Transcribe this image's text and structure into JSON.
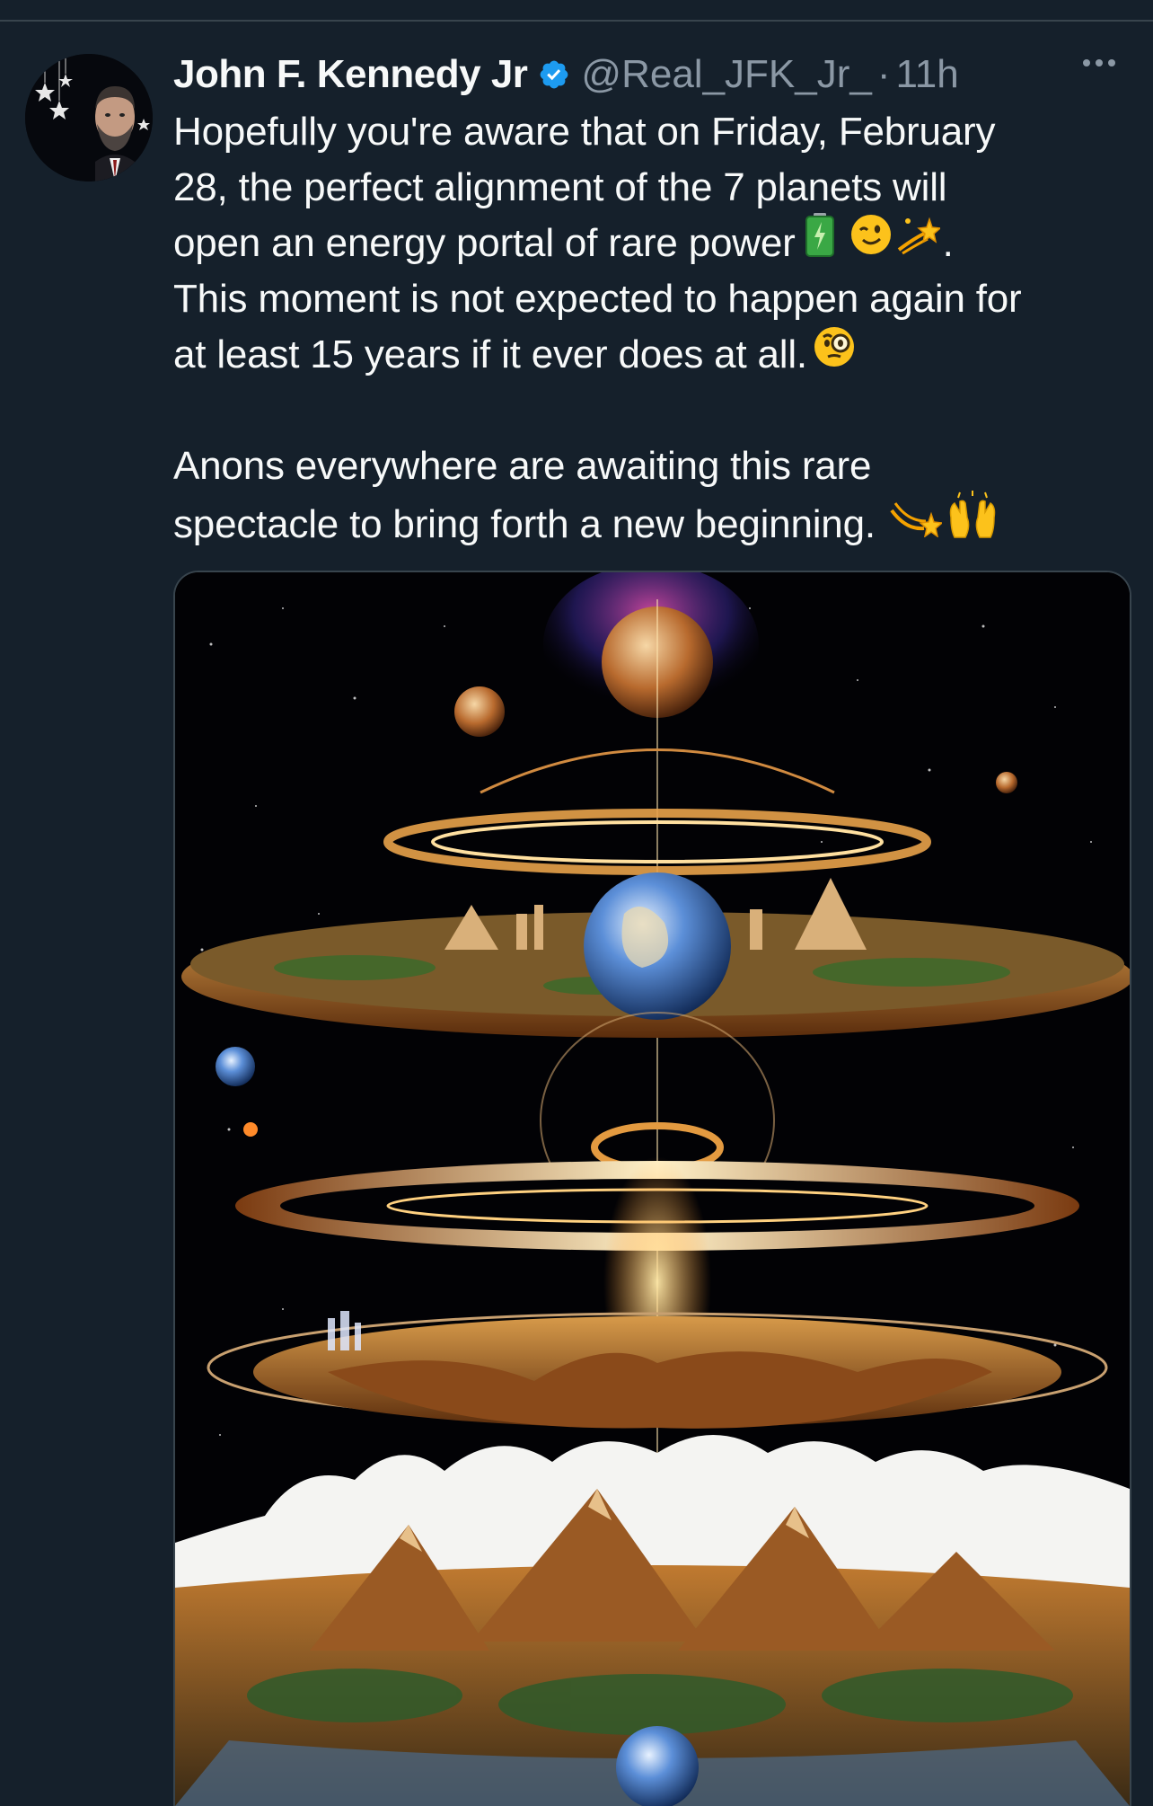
{
  "tweet": {
    "display_name": "John F. Kennedy Jr",
    "handle": "@Real_JFK_Jr_",
    "separator": "·",
    "time": "11h",
    "lines": {
      "l1": "Hopefully you're aware that on Friday, February",
      "l2": "28, the perfect alignment of the 7 planets will",
      "l3": "open an energy portal of rare power",
      "l3_end": ".",
      "l4": "This moment is not expected to happen again for",
      "l5": "at least 15 years if it ever does at all.",
      "l6": "Anons everywhere are awaiting this rare",
      "l7": "spectacle to bring forth a new beginning."
    },
    "emojis": [
      "battery-emoji",
      "winking-face-emoji",
      "dizzy-emoji",
      "face-with-monocle-emoji",
      "raising-hands-emoji"
    ]
  },
  "colors": {
    "background": "#15202b",
    "text_primary": "#f7f9f9",
    "text_secondary": "#8b98a5",
    "verified": "#1d9bf0",
    "divider": "#38444d"
  },
  "media": {
    "icon": "cosmic-flat-earth-illustration"
  }
}
